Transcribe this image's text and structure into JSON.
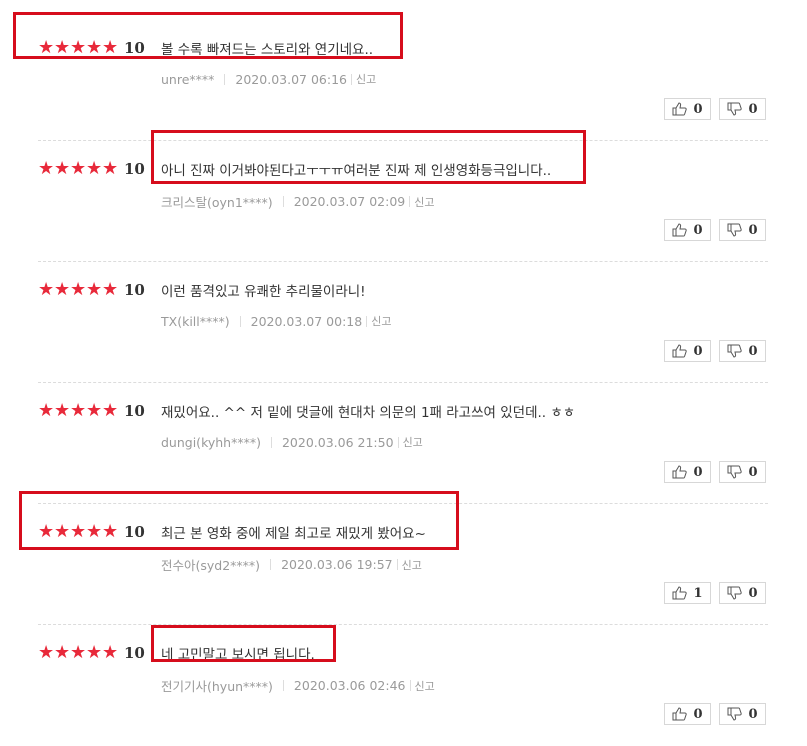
{
  "reviews": [
    {
      "score": "10",
      "text": "볼 수록 빠져드는 스토리와 연기네요..",
      "user": "unre****",
      "date": "2020.03.07 06:16",
      "report": "신고",
      "likes": "0",
      "dislikes": "0"
    },
    {
      "score": "10",
      "text": "아니 진짜 이거봐야된다고ㅜㅜㅠ여러분 진짜 제 인생영화등극입니다..",
      "user": "크리스탈(oyn1****)",
      "date": "2020.03.07 02:09",
      "report": "신고",
      "likes": "0",
      "dislikes": "0"
    },
    {
      "score": "10",
      "text": "이런 품격있고 유쾌한 추리물이라니!",
      "user": "TX(kill****)",
      "date": "2020.03.07 00:18",
      "report": "신고",
      "likes": "0",
      "dislikes": "0"
    },
    {
      "score": "10",
      "text": "재밌어요.. ^^ 저 밑에 댓글에 현대차 의문의 1패 라고쓰여 있던데.. ㅎㅎ",
      "user": "dungi(kyhh****)",
      "date": "2020.03.06 21:50",
      "report": "신고",
      "likes": "0",
      "dislikes": "0"
    },
    {
      "score": "10",
      "text": "최근 본 영화 중에 제일 최고로 재밌게 봤어요~",
      "user": "전수아(syd2****)",
      "date": "2020.03.06 19:57",
      "report": "신고",
      "likes": "1",
      "dislikes": "0"
    },
    {
      "score": "10",
      "text": "네 고민말고 보시면 됩니다.",
      "user": "전기기사(hyun****)",
      "date": "2020.03.06 02:46",
      "report": "신고",
      "likes": "0",
      "dislikes": "0"
    }
  ],
  "colors": {
    "star": "#e8293a",
    "highlight": "#d60d1c"
  },
  "icons": {
    "like": "thumbs-up-icon",
    "dislike": "thumbs-down-icon",
    "star": "star-icon"
  }
}
